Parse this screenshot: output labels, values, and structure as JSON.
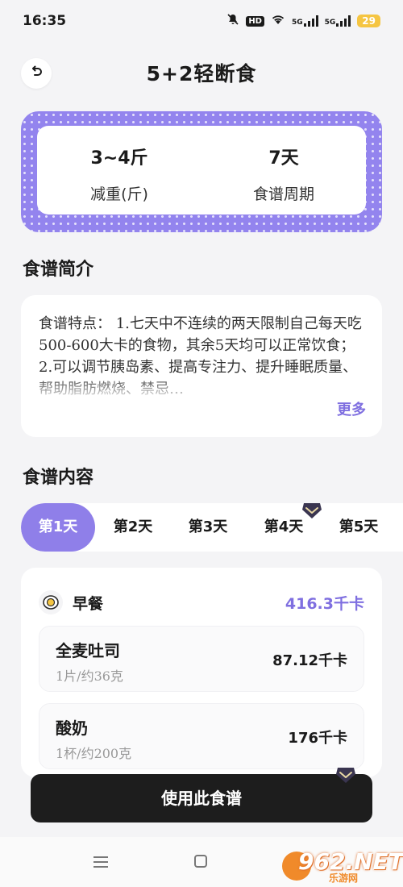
{
  "status_bar": {
    "time": "16:35",
    "hd": "HD",
    "net1": "5G",
    "net2": "5G",
    "battery": "29",
    "icons": [
      "mute-icon",
      "wifi-icon",
      "signal-icon",
      "battery-icon"
    ]
  },
  "header": {
    "title": "5+2轻断食",
    "back_icon": "back-icon"
  },
  "summary": {
    "weight_value": "3~4斤",
    "weight_label": "减重(斤)",
    "period_value": "7天",
    "period_label": "食谱周期"
  },
  "intro": {
    "title": "食谱简介",
    "text": "食谱特点： 1.七天中不连续的两天限制自己每天吃500-600大卡的食物，其余5天均可以正常饮食； 2.可以调节胰岛素、提高专注力、提升睡眠质量、帮助脂肪燃烧、禁忌…",
    "more_label": "更多"
  },
  "content": {
    "title": "食谱内容",
    "days": [
      "第1天",
      "第2天",
      "第3天",
      "第4天",
      "第5天"
    ],
    "active_day": 0
  },
  "meal": {
    "name": "早餐",
    "kcal": "416.3千卡",
    "icon": "egg-icon",
    "foods": [
      {
        "name": "全麦吐司",
        "portion": "1片/约36克",
        "kcal": "87.12千卡"
      },
      {
        "name": "酸奶",
        "portion": "1杯/约200克",
        "kcal": "176千卡"
      }
    ]
  },
  "actions": {
    "use_label": "使用此食谱"
  },
  "watermark": {
    "main": "962.NET",
    "sub": "乐游网"
  },
  "colors": {
    "accent": "#8f7fe9",
    "card_border": "#9384ee",
    "button": "#1d1d1d",
    "background": "#f4f4f6"
  }
}
